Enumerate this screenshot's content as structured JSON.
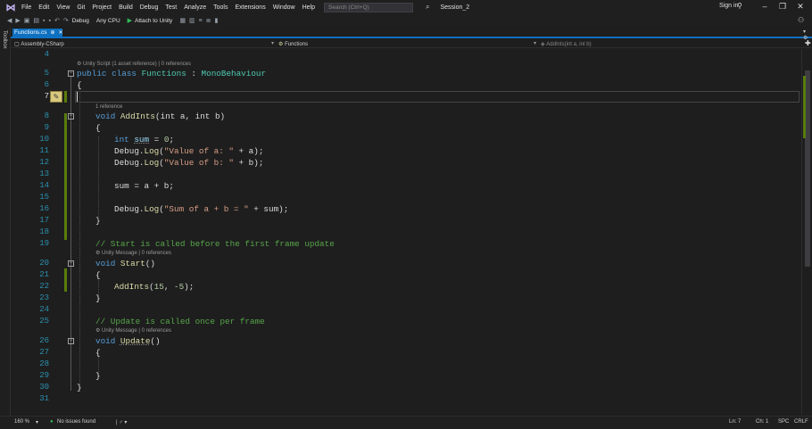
{
  "menu": {
    "items": [
      "File",
      "Edit",
      "View",
      "Git",
      "Project",
      "Build",
      "Debug",
      "Test",
      "Analyze",
      "Tools",
      "Extensions",
      "Window",
      "Help"
    ],
    "search_placeholder": "Search (Ctrl+Q)",
    "solution": "Session_2",
    "signin": "Sign in"
  },
  "toolbar": {
    "config": "Debug",
    "platform": "Any CPU",
    "attach": "Attach to Unity"
  },
  "toolbox_label": "Toolbox",
  "tab": {
    "label": "Functions.cs",
    "pin": "⊕",
    "close": "✕"
  },
  "nav": {
    "project": "Assembly-CSharp",
    "type": "Functions",
    "member": "AddInts(int a, int b)"
  },
  "editor": {
    "lens_class": "Unity Script (1 asset reference) | 0 references",
    "lens_addints": "1 reference",
    "lens_start": "Unity Message | 0 references",
    "lens_update": "Unity Message | 0 references",
    "line_numbers": [
      "4",
      "5",
      "6",
      "7",
      "8",
      "9",
      "10",
      "11",
      "12",
      "13",
      "14",
      "15",
      "16",
      "17",
      "18",
      "19",
      "20",
      "21",
      "22",
      "23",
      "24",
      "25",
      "26",
      "27",
      "28",
      "29",
      "30",
      "31"
    ],
    "code": {
      "l5_kw1": "public",
      "l5_kw2": "class",
      "l5_type1": "Functions",
      "l5_colon": " : ",
      "l5_type2": "MonoBehaviour",
      "open_brace": "{",
      "close_brace": "}",
      "kw_void": "void",
      "kw_int": "int",
      "fn_addints": "AddInts",
      "addints_params_a": "(int a, ",
      "addints_params_b": "int b)",
      "l10_var": "sum",
      "l10_rest": " = ",
      "l10_num": "0",
      "semicolon": ";",
      "debug": "Debug.",
      "log": "Log",
      "l11_str": "\"Value of a: \"",
      "l11_tail": " + a);",
      "l12_str": "\"Value of b: \"",
      "l12_tail": " + b);",
      "l14": "sum = a + b;",
      "l16_str": "\"Sum of a + b = \"",
      "l16_tail": " + sum);",
      "l19_comment": "// Start is called before the first frame update",
      "fn_start": "Start",
      "parens": "()",
      "l22_num1": "15",
      "l22_num2": "-5",
      "comment_update": "// Update is called once per frame",
      "fn_update": "Update"
    }
  },
  "status": {
    "zoom": "160 %",
    "issues": "No issues found",
    "ln": "Ln: 7",
    "ch": "Ch: 1",
    "spc": "SPC",
    "crlf": "CRLF"
  }
}
